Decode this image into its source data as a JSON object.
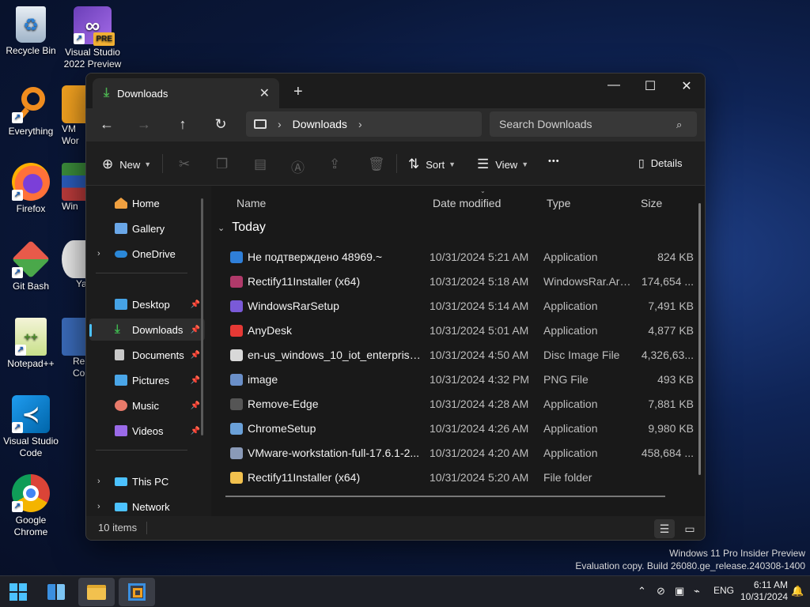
{
  "desktop": {
    "icons": [
      {
        "label": "Recycle Bin",
        "icon": "recycle-bin-icon"
      },
      {
        "label": "Visual Studio 2022 Preview",
        "icon": "visual-studio-preview-icon",
        "badge": "PRE"
      },
      {
        "label": "Everything",
        "icon": "everything-search-icon"
      },
      {
        "label": "VM Wor",
        "icon": "vmware-icon"
      },
      {
        "label": "Firefox",
        "icon": "firefox-icon"
      },
      {
        "label": "Win",
        "icon": "winrar-icon"
      },
      {
        "label": "Git Bash",
        "icon": "git-bash-icon"
      },
      {
        "label": "Ya",
        "icon": "yandex-icon"
      },
      {
        "label": "Notepad++",
        "icon": "notepad-plus-plus-icon"
      },
      {
        "label": "Re Co",
        "icon": "rectify-icon"
      },
      {
        "label": "Visual Studio Code",
        "icon": "vscode-icon"
      },
      {
        "label": "Google Chrome",
        "icon": "chrome-icon"
      }
    ],
    "watermark": {
      "line1": "Windows 11 Pro Insider Preview",
      "line2": "Evaluation copy. Build 26080.ge_release.240308-1400"
    }
  },
  "explorer": {
    "tab_title": "Downloads",
    "new_tab_label": "+",
    "window_controls": {
      "minimize": "—",
      "maximize": "☐",
      "close": "✕"
    },
    "address": {
      "crumbs": [
        "Downloads"
      ],
      "separator": "›"
    },
    "search": {
      "placeholder": "Search Downloads"
    },
    "command_bar": {
      "new_label": "New",
      "sort_label": "Sort",
      "view_label": "View",
      "more_label": "•••",
      "details_label": "Details"
    },
    "sidebar": {
      "items": [
        {
          "label": "Home",
          "icon": "home-icon",
          "color": "#f0a040"
        },
        {
          "label": "Gallery",
          "icon": "gallery-icon",
          "color": "#6aa7e8"
        },
        {
          "label": "OneDrive",
          "icon": "onedrive-icon",
          "color": "#2b88d8",
          "expandable": true
        },
        {
          "label": "Desktop",
          "icon": "desktop-folder-icon",
          "color": "#46a3e6",
          "pinned": true
        },
        {
          "label": "Downloads",
          "icon": "downloads-folder-icon",
          "color": "#3fb950",
          "pinned": true,
          "active": true
        },
        {
          "label": "Documents",
          "icon": "documents-folder-icon",
          "color": "#c8c8c8",
          "pinned": true
        },
        {
          "label": "Pictures",
          "icon": "pictures-folder-icon",
          "color": "#4aa6e8",
          "pinned": true
        },
        {
          "label": "Music",
          "icon": "music-folder-icon",
          "color": "#e87a6a",
          "pinned": true
        },
        {
          "label": "Videos",
          "icon": "videos-folder-icon",
          "color": "#9a6ae8",
          "pinned": true
        },
        {
          "label": "This PC",
          "icon": "this-pc-icon",
          "color": "#4cc2ff",
          "expandable": true
        },
        {
          "label": "Network",
          "icon": "network-icon",
          "color": "#4cc2ff",
          "expandable": true
        }
      ]
    },
    "columns": {
      "name": "Name",
      "date": "Date modified",
      "type": "Type",
      "size": "Size"
    },
    "group_label": "Today",
    "files": [
      {
        "name": "Не подтверждено 48969.~",
        "date": "10/31/2024 5:21 AM",
        "type": "Application",
        "size": "824 KB",
        "icon": "installer-shield-icon",
        "color": "#2f7fd8"
      },
      {
        "name": "Rectify11Installer (x64)",
        "date": "10/31/2024 5:18 AM",
        "type": "WindowsRar.Arc...",
        "size": "174,654 ...",
        "icon": "rar-archive-icon",
        "color": "#b03a6a"
      },
      {
        "name": "WindowsRarSetup",
        "date": "10/31/2024 5:14 AM",
        "type": "Application",
        "size": "7,491 KB",
        "icon": "winrar-setup-icon",
        "color": "#7a5ad8"
      },
      {
        "name": "AnyDesk",
        "date": "10/31/2024 5:01 AM",
        "type": "Application",
        "size": "4,877 KB",
        "icon": "anydesk-icon",
        "color": "#e53935"
      },
      {
        "name": "en-us_windows_10_iot_enterprise_...",
        "date": "10/31/2024 4:50 AM",
        "type": "Disc Image File",
        "size": "4,326,63...",
        "icon": "disc-image-icon",
        "color": "#d8d8d8"
      },
      {
        "name": "image",
        "date": "10/31/2024 4:32 PM",
        "type": "PNG File",
        "size": "493 KB",
        "icon": "png-image-icon",
        "color": "#6a8fc8"
      },
      {
        "name": "Remove-Edge",
        "date": "10/31/2024 4:28 AM",
        "type": "Application",
        "size": "7,881 KB",
        "icon": "remove-edge-icon",
        "color": "#555555"
      },
      {
        "name": "ChromeSetup",
        "date": "10/31/2024 4:26 AM",
        "type": "Application",
        "size": "9,980 KB",
        "icon": "chrome-setup-icon",
        "color": "#6aa0d8"
      },
      {
        "name": "VMware-workstation-full-17.6.1-2...",
        "date": "10/31/2024 4:20 AM",
        "type": "Application",
        "size": "458,684 ...",
        "icon": "vmware-installer-icon",
        "color": "#8a9ab8"
      },
      {
        "name": "Rectify11Installer (x64)",
        "date": "10/31/2024 5:20 AM",
        "type": "File folder",
        "size": "",
        "icon": "folder-icon",
        "color": "#f2c14e"
      }
    ],
    "status": {
      "item_count": "10 items"
    }
  },
  "taskbar": {
    "items": [
      {
        "icon": "windows-start-icon"
      },
      {
        "icon": "widgets-icon"
      },
      {
        "icon": "file-explorer-icon",
        "active": true
      },
      {
        "icon": "vmware-taskbar-icon",
        "active": true
      }
    ],
    "language": "ENG",
    "time": "6:11 AM",
    "date": "10/31/2024"
  }
}
